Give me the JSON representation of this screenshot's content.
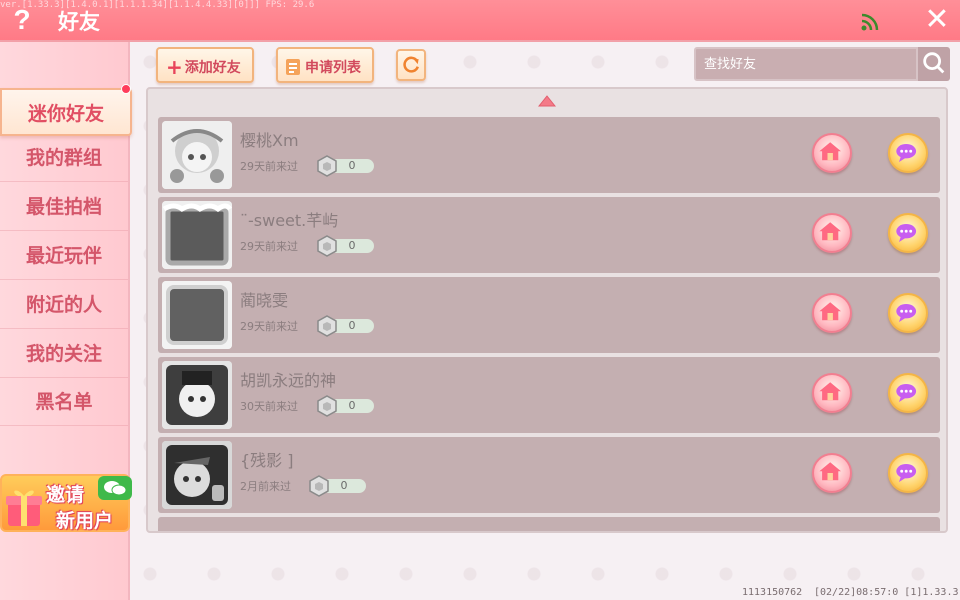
{
  "app": {
    "title": "好友",
    "version_text": "ver.[1.33.3][1.4.0.1][1.1.1.34][1.1.4.4.33][0]]] FPS: 29.6"
  },
  "sidebar": {
    "items": [
      {
        "label": "迷你好友",
        "active": true
      },
      {
        "label": "我的群组",
        "active": false
      },
      {
        "label": "最佳拍档",
        "active": false
      },
      {
        "label": "最近玩伴",
        "active": false
      },
      {
        "label": "附近的人",
        "active": false
      },
      {
        "label": "我的关注",
        "active": false
      },
      {
        "label": "黑名单",
        "active": false
      }
    ],
    "invite": {
      "line1": "邀请",
      "line2": "新用户"
    }
  },
  "toolbar": {
    "add_friend_label": "添加好友",
    "request_list_label": "申请列表",
    "search_placeholder": "查找好友"
  },
  "friends": [
    {
      "name": "樱桃Ⅹm",
      "last_seen": "29天前来过",
      "level": "0"
    },
    {
      "name": "¨-sweet.芊屿",
      "last_seen": "29天前来过",
      "level": "0"
    },
    {
      "name": "蔺晓雯",
      "last_seen": "29天前来过",
      "level": "0"
    },
    {
      "name": "胡凯永远的神",
      "last_seen": "30天前来过",
      "level": "0"
    },
    {
      "name": "{残影 ]",
      "last_seen": "2月前来过",
      "level": "0"
    }
  ],
  "footer": {
    "id": "1113150762",
    "time": "[02/22]08:57:0  [1]1.33.3"
  },
  "colors": {
    "topbar": "#ff7a86",
    "sidebar_text": "#d4566a",
    "row_bg": "#c4afb1"
  }
}
